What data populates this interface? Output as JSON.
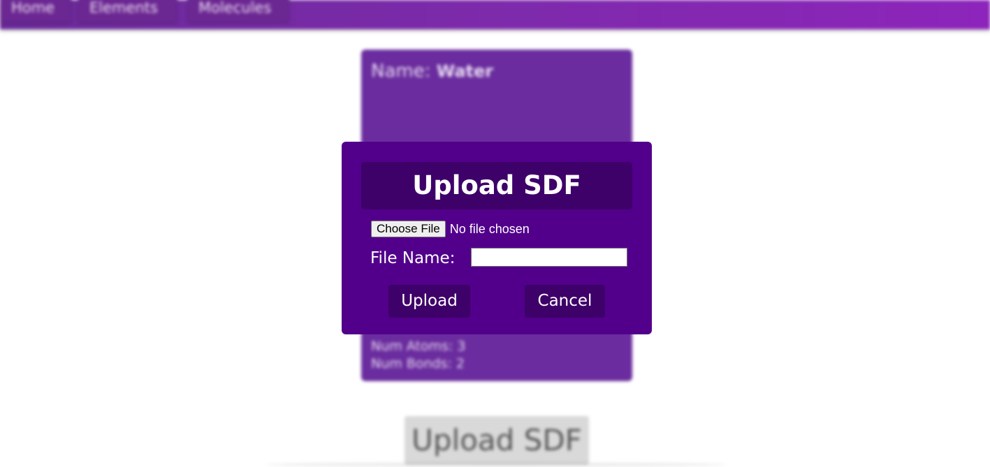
{
  "navbar": {
    "items": [
      {
        "label": "Home"
      },
      {
        "label": "Elements"
      },
      {
        "label": "Molecules"
      }
    ]
  },
  "molecule_card": {
    "name_label": "Name:",
    "name_value": "Water",
    "num_atoms_label": "Num Atoms:",
    "num_atoms_value": "3",
    "num_bonds_label": "Num Bonds:",
    "num_bonds_value": "2"
  },
  "page_upload_button": {
    "label": "Upload SDF"
  },
  "modal": {
    "title": "Upload SDF",
    "choose_file_label": "Choose File",
    "no_file_text": "No file chosen",
    "file_name_label": "File Name:",
    "file_name_value": "",
    "upload_label": "Upload",
    "cancel_label": "Cancel"
  },
  "colors": {
    "navbar": "#7d2aab",
    "card": "#6a2c9e",
    "modal_bg": "#52008b",
    "modal_accent": "#3e0069"
  }
}
